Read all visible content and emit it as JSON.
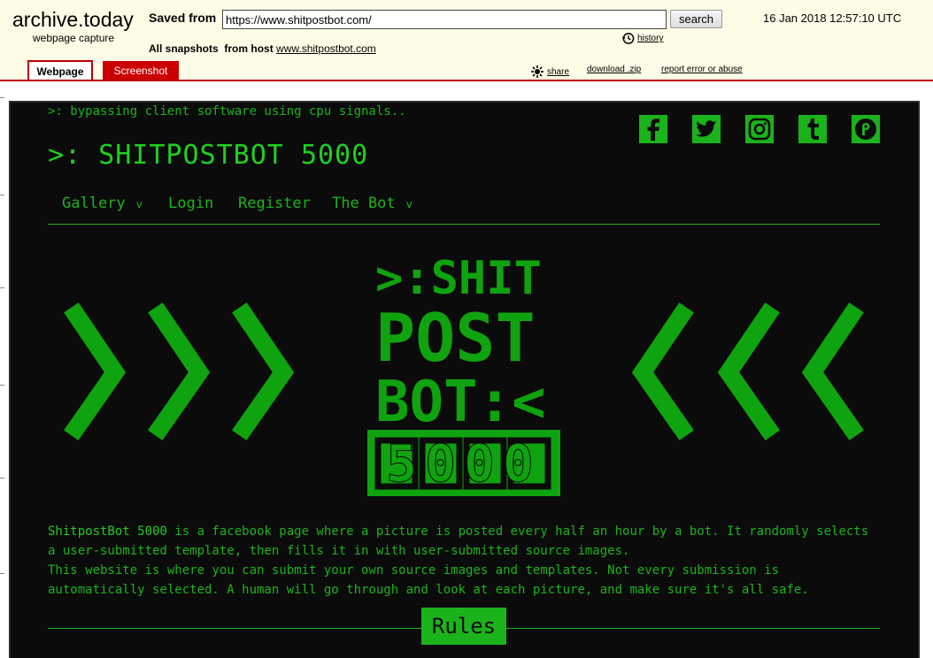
{
  "archive": {
    "logo": "archive.today",
    "logo_sub": "webpage capture",
    "saved_from_label": "Saved from",
    "url_value": "https://www.shitpostbot.com/",
    "search_label": "search",
    "date": "16 Jan 2018 12:57:10 UTC",
    "history_label": "history",
    "snapshots_label": "All snapshots",
    "from_host_label": "from host",
    "host_link": "www.shitpostbot.com",
    "tabs": [
      {
        "label": "Webpage",
        "active": true
      },
      {
        "label": "Screenshot",
        "active": false
      }
    ],
    "share_label": "share",
    "download_label": "download .zip",
    "report_label": "report error or abuse",
    "accent_color": "#b00000"
  },
  "site": {
    "tagline": ">: bypassing client software using cpu signals..",
    "title": ">: SHITPOSTBOT 5000",
    "social": [
      "facebook-icon",
      "twitter-icon",
      "instagram-icon",
      "tumblr-icon",
      "patreon-icon"
    ],
    "nav": [
      {
        "label": "Gallery",
        "caret": "v"
      },
      {
        "label": "Login",
        "caret": ""
      },
      {
        "label": "Register",
        "caret": ""
      },
      {
        "label": "The Bot",
        "caret": "v"
      }
    ],
    "logo_lines": [
      ">:SHIT",
      "POST",
      "BOT:<",
      "5000"
    ],
    "description_link": "ShitpostBot 5000",
    "description_1": " is a facebook page where a picture is posted every half an hour by a bot. It randomly selects a user-submitted template, then fills it in with user-submitted source images.",
    "description_2": "This website is where you can submit your own source images and templates. Not every submission is automatically selected. A human will go through and look at each picture, and make sure it's all safe.",
    "rules_label": "Rules",
    "green": "#1bb31b",
    "background": "#0b0b0b"
  }
}
